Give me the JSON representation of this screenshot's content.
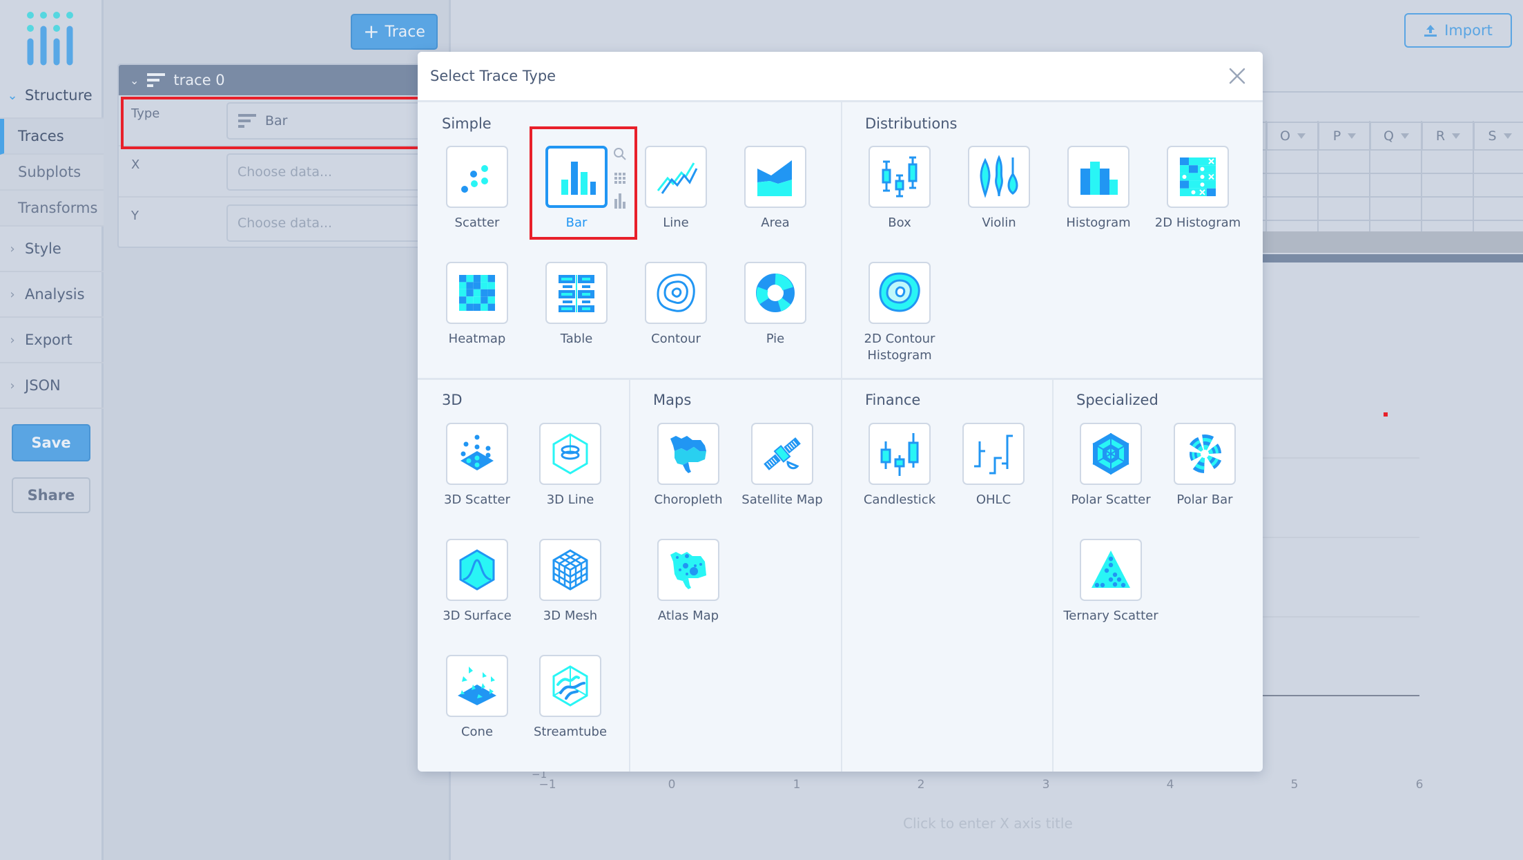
{
  "sidebar": {
    "logo": "plotly-logo",
    "groups": [
      {
        "label": "Structure",
        "open": true,
        "items": [
          {
            "label": "Traces",
            "active": true
          },
          {
            "label": "Subplots"
          },
          {
            "label": "Transforms"
          }
        ]
      },
      {
        "label": "Style"
      },
      {
        "label": "Analysis"
      },
      {
        "label": "Export"
      },
      {
        "label": "JSON"
      }
    ],
    "save_label": "Save",
    "share_label": "Share"
  },
  "panel": {
    "add_trace_label": "Trace",
    "trace": {
      "name": "trace 0",
      "type_label": "Type",
      "type_value": "Bar",
      "x_label": "X",
      "x_placeholder": "Choose data...",
      "y_label": "Y",
      "y_placeholder": "Choose data..."
    }
  },
  "grid": {
    "import_label": "Import",
    "columns": [
      "O",
      "P",
      "Q",
      "R",
      "S"
    ]
  },
  "plot": {
    "x_ticks": [
      "−1",
      "0",
      "1",
      "2",
      "3",
      "4",
      "5",
      "6"
    ],
    "y_tick_bottom": "−1",
    "x_axis_title_placeholder": "Click to enter X axis title"
  },
  "modal": {
    "title": "Select Trace Type",
    "selected": "Bar",
    "sections": {
      "simple": {
        "title": "Simple",
        "items": [
          "Scatter",
          "Bar",
          "Line",
          "Area",
          "Heatmap",
          "Table",
          "Contour",
          "Pie"
        ]
      },
      "distributions": {
        "title": "Distributions",
        "items": [
          "Box",
          "Violin",
          "Histogram",
          "2D Histogram",
          "2D Contour Histogram"
        ]
      },
      "three_d": {
        "title": "3D",
        "items": [
          "3D Scatter",
          "3D Line",
          "3D Surface",
          "3D Mesh",
          "Cone",
          "Streamtube"
        ]
      },
      "maps": {
        "title": "Maps",
        "items": [
          "Choropleth",
          "Satellite Map",
          "Atlas Map"
        ]
      },
      "finance": {
        "title": "Finance",
        "items": [
          "Candlestick",
          "OHLC"
        ]
      },
      "specialized": {
        "title": "Specialized",
        "items": [
          "Polar Scatter",
          "Polar Bar",
          "Ternary Scatter"
        ]
      }
    }
  },
  "colors": {
    "accent": "#2196f3",
    "icon_dark": "#2196f3",
    "icon_light": "#29f5f5",
    "highlight": "#e8202a"
  }
}
